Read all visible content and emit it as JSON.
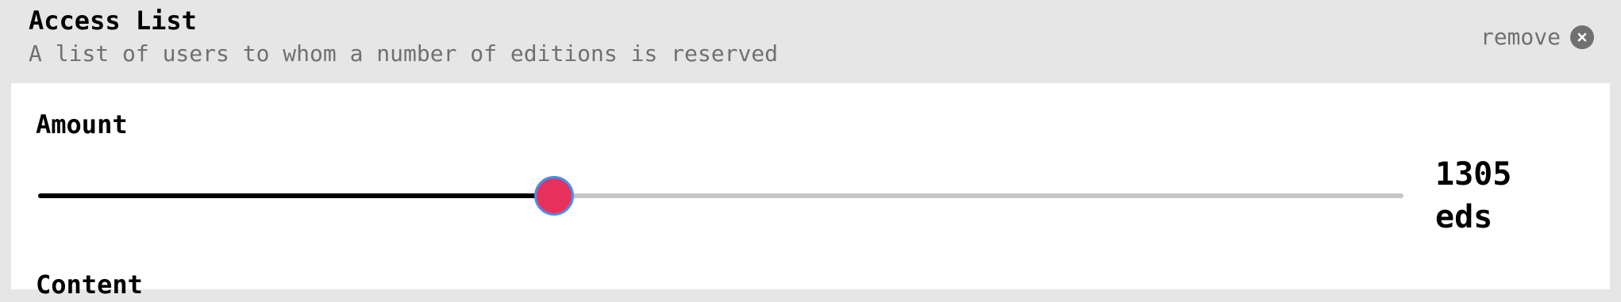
{
  "header": {
    "title": "Access List",
    "subtitle": "A list of users to whom a number of editions is reserved",
    "remove_label": "remove"
  },
  "amount": {
    "label": "Amount",
    "value": "1305",
    "unit": "eds",
    "slider_fraction": 0.378
  },
  "content": {
    "label": "Content"
  },
  "colors": {
    "thumb": "#e8305c",
    "thumb_border": "#4a8fe6",
    "track": "#c6c6c6",
    "track_fill": "#000000",
    "header_bg": "#e6e6e6"
  }
}
